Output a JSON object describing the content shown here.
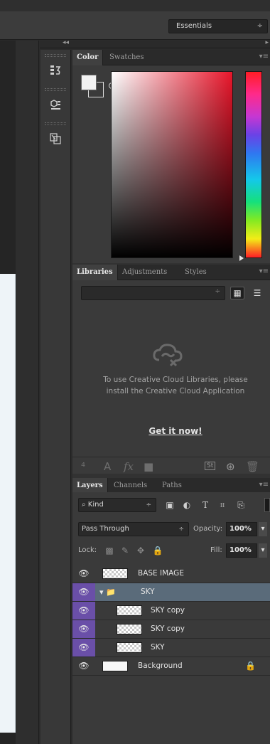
{
  "options_bar": {
    "workspace": "Essentials",
    "workspace_arrow": "÷"
  },
  "color_panel": {
    "tabs": [
      "Color",
      "Swatches"
    ],
    "foreground_color": "#f2f2f2",
    "background_color": "#3a3a3a"
  },
  "libraries_panel": {
    "tabs": [
      "Libraries",
      "Adjustments",
      "Styles"
    ],
    "select_arrow": "÷",
    "message": "To use Creative Cloud Libraries, please install the Creative Cloud Application",
    "link": "Get it now!",
    "footer_stock": "St"
  },
  "layers_panel": {
    "tabs": [
      "Layers",
      "Channels",
      "Paths"
    ],
    "kind_filter": "Kind",
    "select_arrow": "÷",
    "blend_mode": "Pass Through",
    "opacity_label": "Opacity:",
    "opacity_value": "100%",
    "lock_label": "Lock:",
    "fill_label": "Fill:",
    "fill_value": "100%",
    "layers": [
      {
        "name": "BASE IMAGE",
        "type": "image",
        "indent": 0,
        "tag_color": "",
        "locked": false
      },
      {
        "name": "SKY",
        "type": "group",
        "indent": 0,
        "tag_color": "#6a4fa8",
        "locked": false,
        "expanded": true
      },
      {
        "name": "SKY copy",
        "type": "image",
        "indent": 1,
        "tag_color": "#6a4fa8",
        "locked": false
      },
      {
        "name": "SKY copy",
        "type": "image",
        "indent": 1,
        "tag_color": "#6a4fa8",
        "locked": false
      },
      {
        "name": "SKY",
        "type": "image",
        "indent": 1,
        "tag_color": "#6a4fa8",
        "locked": false
      },
      {
        "name": "Background",
        "type": "background",
        "indent": 0,
        "tag_color": "",
        "locked": true
      }
    ]
  }
}
